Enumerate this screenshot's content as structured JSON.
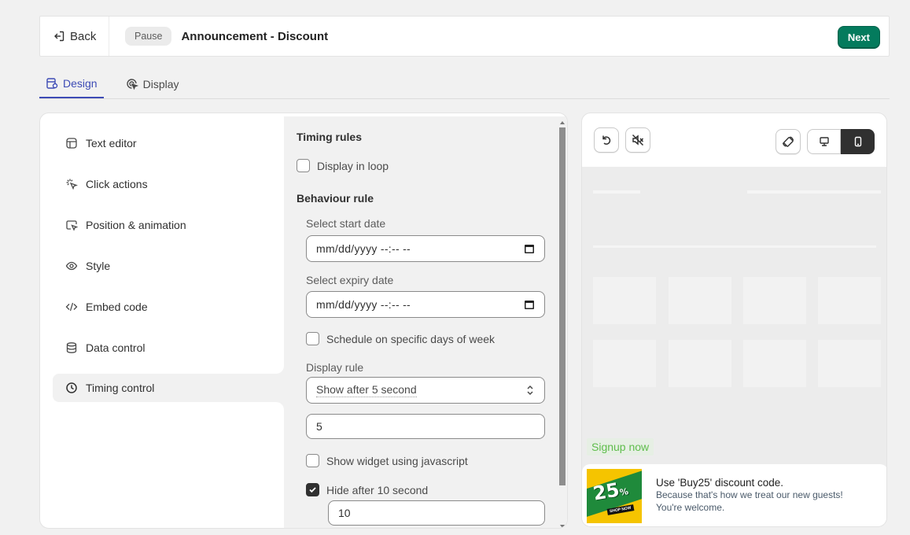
{
  "topbar": {
    "back_label": "Back",
    "status": "Pause",
    "title": "Announcement - Discount",
    "next_label": "Next"
  },
  "tabs": [
    {
      "label": "Design",
      "active": true
    },
    {
      "label": "Display",
      "active": false
    }
  ],
  "nav": [
    {
      "label": "Text editor",
      "icon": "layout-icon"
    },
    {
      "label": "Click actions",
      "icon": "cursor-click-icon"
    },
    {
      "label": "Position & animation",
      "icon": "cursor-box-icon"
    },
    {
      "label": "Style",
      "icon": "eye-icon"
    },
    {
      "label": "Embed code",
      "icon": "code-icon"
    },
    {
      "label": "Data control",
      "icon": "database-icon"
    },
    {
      "label": "Timing control",
      "icon": "clock-icon",
      "active": true
    }
  ],
  "settings": {
    "timing_title": "Timing rules",
    "display_in_loop": {
      "label": "Display in loop",
      "checked": false
    },
    "behaviour_title": "Behaviour rule",
    "start_date_label": "Select start date",
    "start_date_value": "mm/dd/yyyy --:-- --",
    "expiry_date_label": "Select expiry date",
    "expiry_date_value": "mm/dd/yyyy --:-- --",
    "schedule_days": {
      "label": "Schedule on specific days of week",
      "checked": false
    },
    "display_rule_label": "Display rule",
    "display_rule_value": "Show after 5 second",
    "display_rule_seconds": "5",
    "show_js": {
      "label": "Show widget using javascript",
      "checked": false
    },
    "hide_after": {
      "label": "Hide after 10 second",
      "checked": true
    },
    "hide_after_seconds": "10"
  },
  "preview": {
    "signup_label": "Signup now",
    "toast_title": "Use 'Buy25' discount code.",
    "toast_line1": "Because that's how we treat our new guests!",
    "toast_line2": "You're welcome.",
    "promo": {
      "number": "25",
      "pct": "%",
      "off": "OFF",
      "shop": "SHOP NOW"
    },
    "device_selected": "mobile"
  },
  "colors": {
    "primary": "#047b5d",
    "tab_active": "#3d4bb5",
    "signup_green": "#5fbd4c"
  }
}
